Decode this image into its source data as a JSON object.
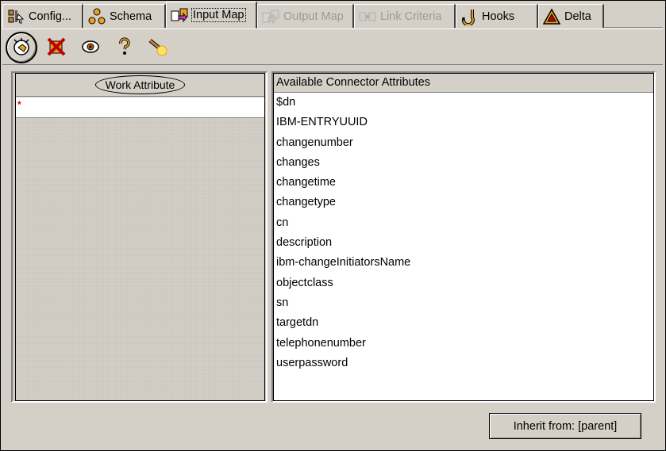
{
  "tabs": [
    {
      "label": "Config...",
      "icon": "config-icon",
      "state": "normal"
    },
    {
      "label": "Schema",
      "icon": "schema-icon",
      "state": "normal"
    },
    {
      "label": "Input Map",
      "icon": "input-map-icon",
      "state": "active"
    },
    {
      "label": "Output Map",
      "icon": "output-map-icon",
      "state": "disabled"
    },
    {
      "label": "Link Criteria",
      "icon": "link-criteria-icon",
      "state": "disabled"
    },
    {
      "label": "Hooks",
      "icon": "hooks-icon",
      "state": "normal"
    },
    {
      "label": "Delta",
      "icon": "delta-icon",
      "state": "normal"
    }
  ],
  "toolbar": {
    "buttons": [
      "add-attribute-icon",
      "delete-icon",
      "view-icon",
      "help-icon",
      "torch-icon"
    ]
  },
  "left_panel": {
    "header": "Work Attribute",
    "new_row_marker": "*"
  },
  "right_panel": {
    "header": "Available Connector Attributes",
    "items": [
      "$dn",
      "IBM-ENTRYUUID",
      "changenumber",
      "changes",
      "changetime",
      "changetype",
      "cn",
      "description",
      "ibm-changeInitiatorsName",
      "objectclass",
      "sn",
      "targetdn",
      "telephonenumber",
      "userpassword"
    ]
  },
  "inherit_button": {
    "label": "Inherit from: [parent]"
  },
  "colors": {
    "background": "#d4d0c8",
    "disabled_text": "#9a9a9a",
    "marker": "#e00000"
  }
}
